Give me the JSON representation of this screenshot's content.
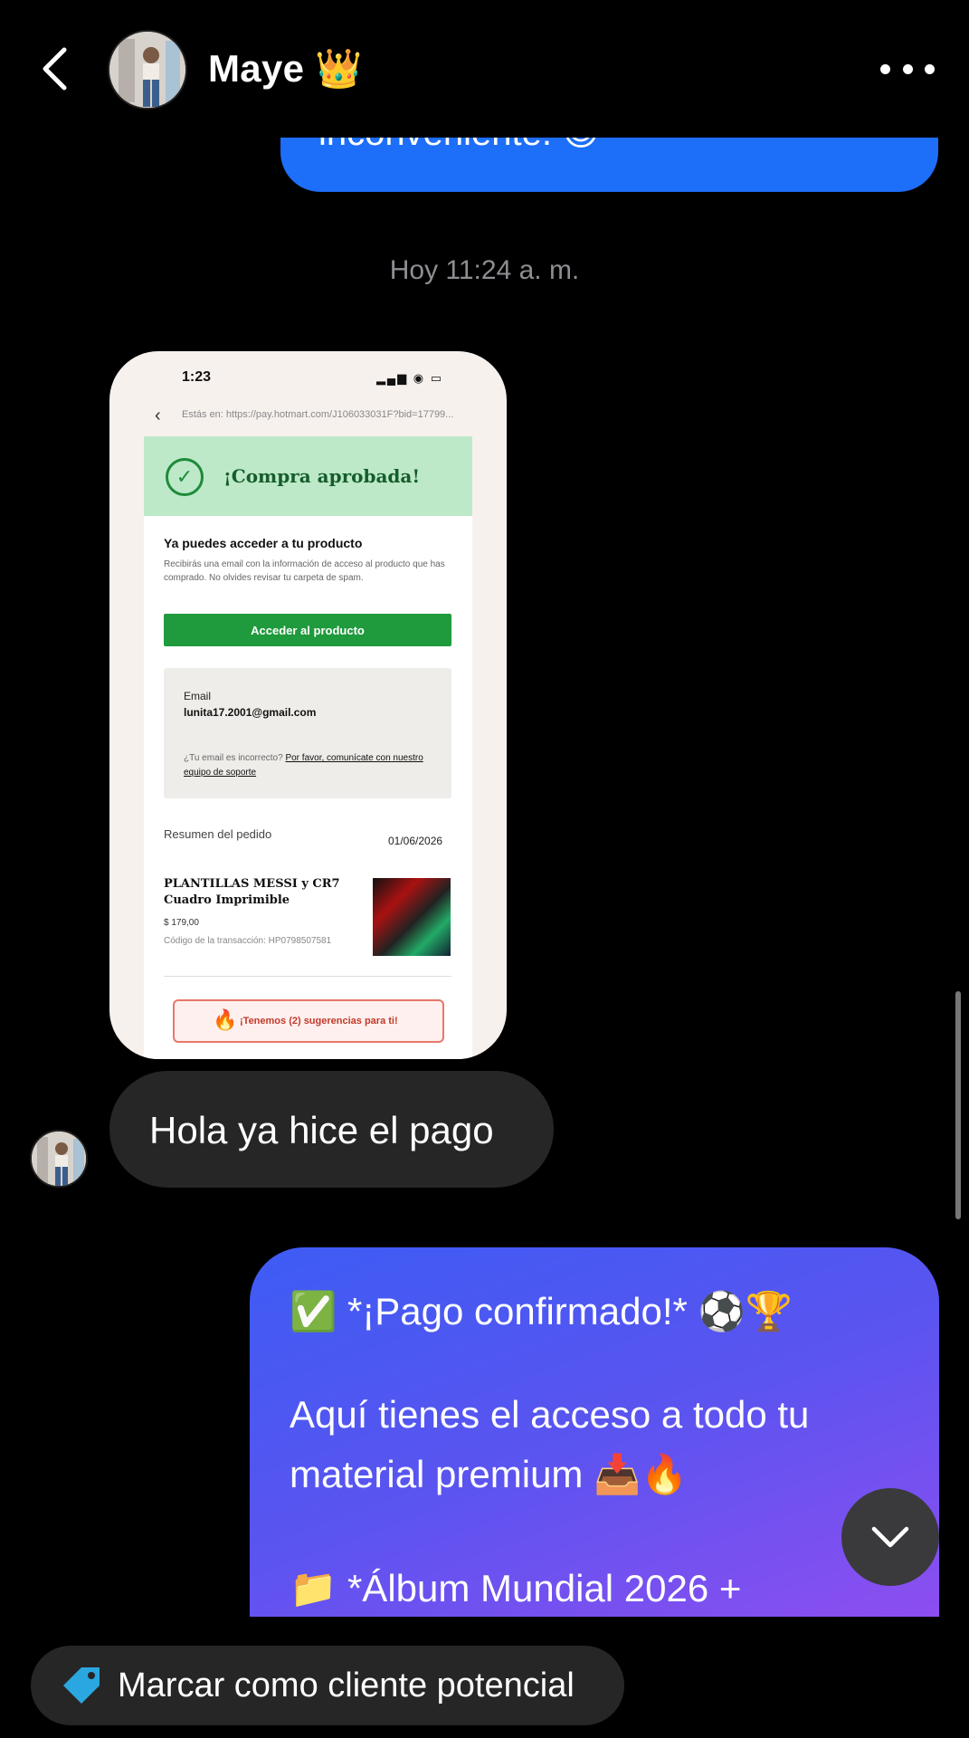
{
  "header": {
    "contact_name": "Maye 👑",
    "back_icon": "chevron-left-icon",
    "more_icon": "more-horizontal-icon"
  },
  "messages": {
    "partial_top": "inconveniente. 😊",
    "timestamp": "Hoy 11:24 a. m.",
    "image": {
      "status_time": "1:23",
      "url": "Estás en: https://pay.hotmart.com/J106033031F?bid=17799...",
      "approved_title": "¡Compra aprobada!",
      "access_title": "Ya puedes acceder a tu producto",
      "access_desc": "Recibirás una email con la información de acceso al producto que has comprado. No olvides revisar tu carpeta de spam.",
      "access_button": "Acceder al producto",
      "email_label": "Email",
      "email_value": "lunita17.2001@gmail.com",
      "email_help_prefix": "¿Tu email es incorrecto? ",
      "email_help_link": "Por favor, comunícate con nuestro equipo de soporte",
      "summary_label": "Resumen del pedido",
      "summary_date": "01/06/2026",
      "product_name": "PLANTILLAS MESSI y CR7 Cuadro Imprimible",
      "product_price": "$ 179,00",
      "transaction": "Código de la transacción: HP0798507581",
      "suggestion": "¡Tenemos (2) sugerencias para ti!"
    },
    "incoming_text": "Hola ya hice el pago",
    "outgoing": {
      "line1": "✅ *¡Pago confirmado!* ⚽🏆",
      "line2": "Aquí tienes el acceso a todo tu",
      "line3": "material premium 📥🔥",
      "line4": "📁 *Álbum Mundial 2026 +"
    }
  },
  "footer": {
    "lead_button": "Marcar como cliente potencial",
    "tag_icon": "tag-icon"
  },
  "colors": {
    "background": "#000000",
    "outgoing_blue": "#1d6ef8",
    "incoming_gray": "#262626",
    "gradient_start": "#3d5cf4",
    "gradient_end": "#8d4ef0",
    "tag_blue": "#2aa7e0"
  }
}
